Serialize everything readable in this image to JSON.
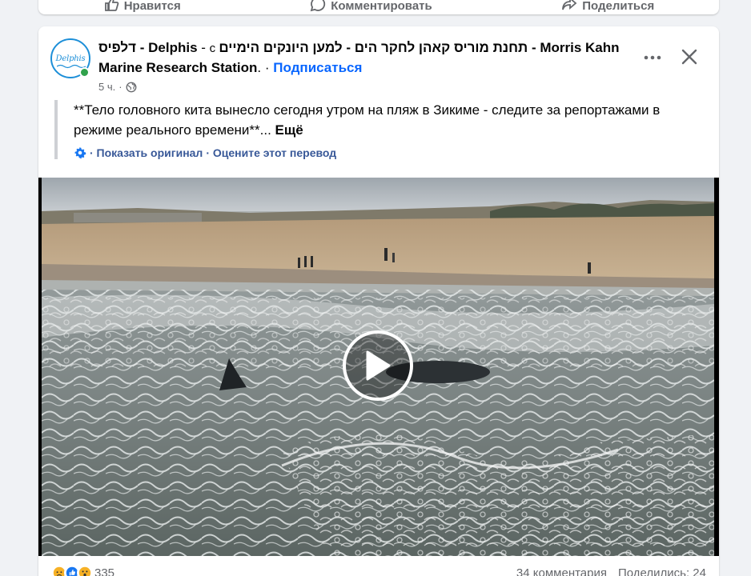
{
  "previous_post": {
    "actions": [
      {
        "icon": "like-icon",
        "label": "Нравится"
      },
      {
        "icon": "comment-icon",
        "label": "Комментировать"
      },
      {
        "icon": "share-icon",
        "label": "Поделиться"
      }
    ]
  },
  "post": {
    "author": "דלפיס - Delphis",
    "dash": " - ",
    "with_word": " с ",
    "co_author": "תחנת מוריס קאהן לחקר הים - למען היונקים הימיים - Morris Kahn Marine Research Station",
    "dot_follow": ". · ",
    "follow_label": "Подписаться",
    "avatar_text": "Delphis",
    "time": "5 ч.",
    "time_sep": "·",
    "text": "**Тело головного кита вынесло сегодня утром на пляж в Зикиме - следите за репортажами в режиме реального времени**...",
    "more_label": "Ещё",
    "show_original": "· Показать оригинал",
    "rate_translation": "· Оцените этот перевод"
  },
  "footer": {
    "reaction_count": "335",
    "comments": "34 комментария",
    "shares": "Поделились: 24"
  },
  "colors": {
    "accent": "#0866ff",
    "online": "#31a24c",
    "muted": "#65676b"
  }
}
